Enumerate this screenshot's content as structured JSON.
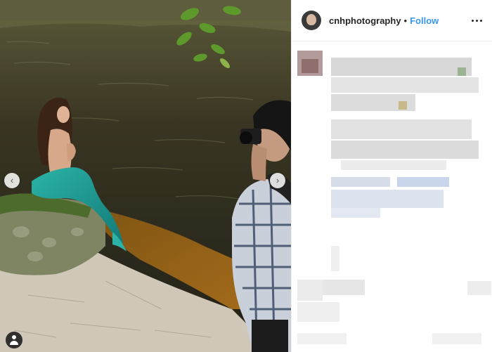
{
  "post": {
    "username": "cnhphotography",
    "separator": "•",
    "follow_label": "Follow"
  },
  "media": {
    "prev_arrow": "‹",
    "next_arrow": "›",
    "tag_icon": "user-tag-icon"
  },
  "colors": {
    "follow": "#3897f0",
    "text": "#262626",
    "border": "#efefef",
    "water_dark": "#2a2418",
    "mermaid_tail": "#1f9e97"
  }
}
